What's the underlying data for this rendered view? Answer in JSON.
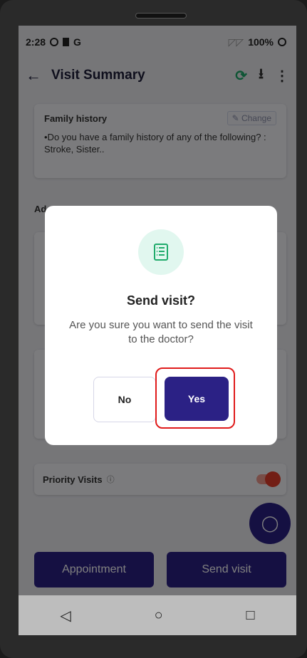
{
  "status": {
    "time": "2:28",
    "letter": "G",
    "battery": "100%"
  },
  "appbar": {
    "title": "Visit Summary",
    "back_icon": "←",
    "sync_icon": "⟳",
    "download_icon": "⭳",
    "menu_icon": "⋮"
  },
  "family_history": {
    "title": "Family history",
    "change_label": "Change",
    "text": "•Do you have a family history of any of the following? : Stroke, Sister.."
  },
  "additional": {
    "label": "Ad"
  },
  "priority": {
    "label": "Priority Visits",
    "help_icon": "?"
  },
  "buttons": {
    "appointment": "Appointment",
    "send_visit": "Send visit"
  },
  "dialog": {
    "title": "Send visit?",
    "message": "Are you sure you want to send the visit to the doctor?",
    "no_label": "No",
    "yes_label": "Yes"
  },
  "colors": {
    "primary": "#2b2185",
    "accent_green": "#1fab6b",
    "toggle_red": "#e53d2a",
    "highlight": "#e01b1b"
  }
}
